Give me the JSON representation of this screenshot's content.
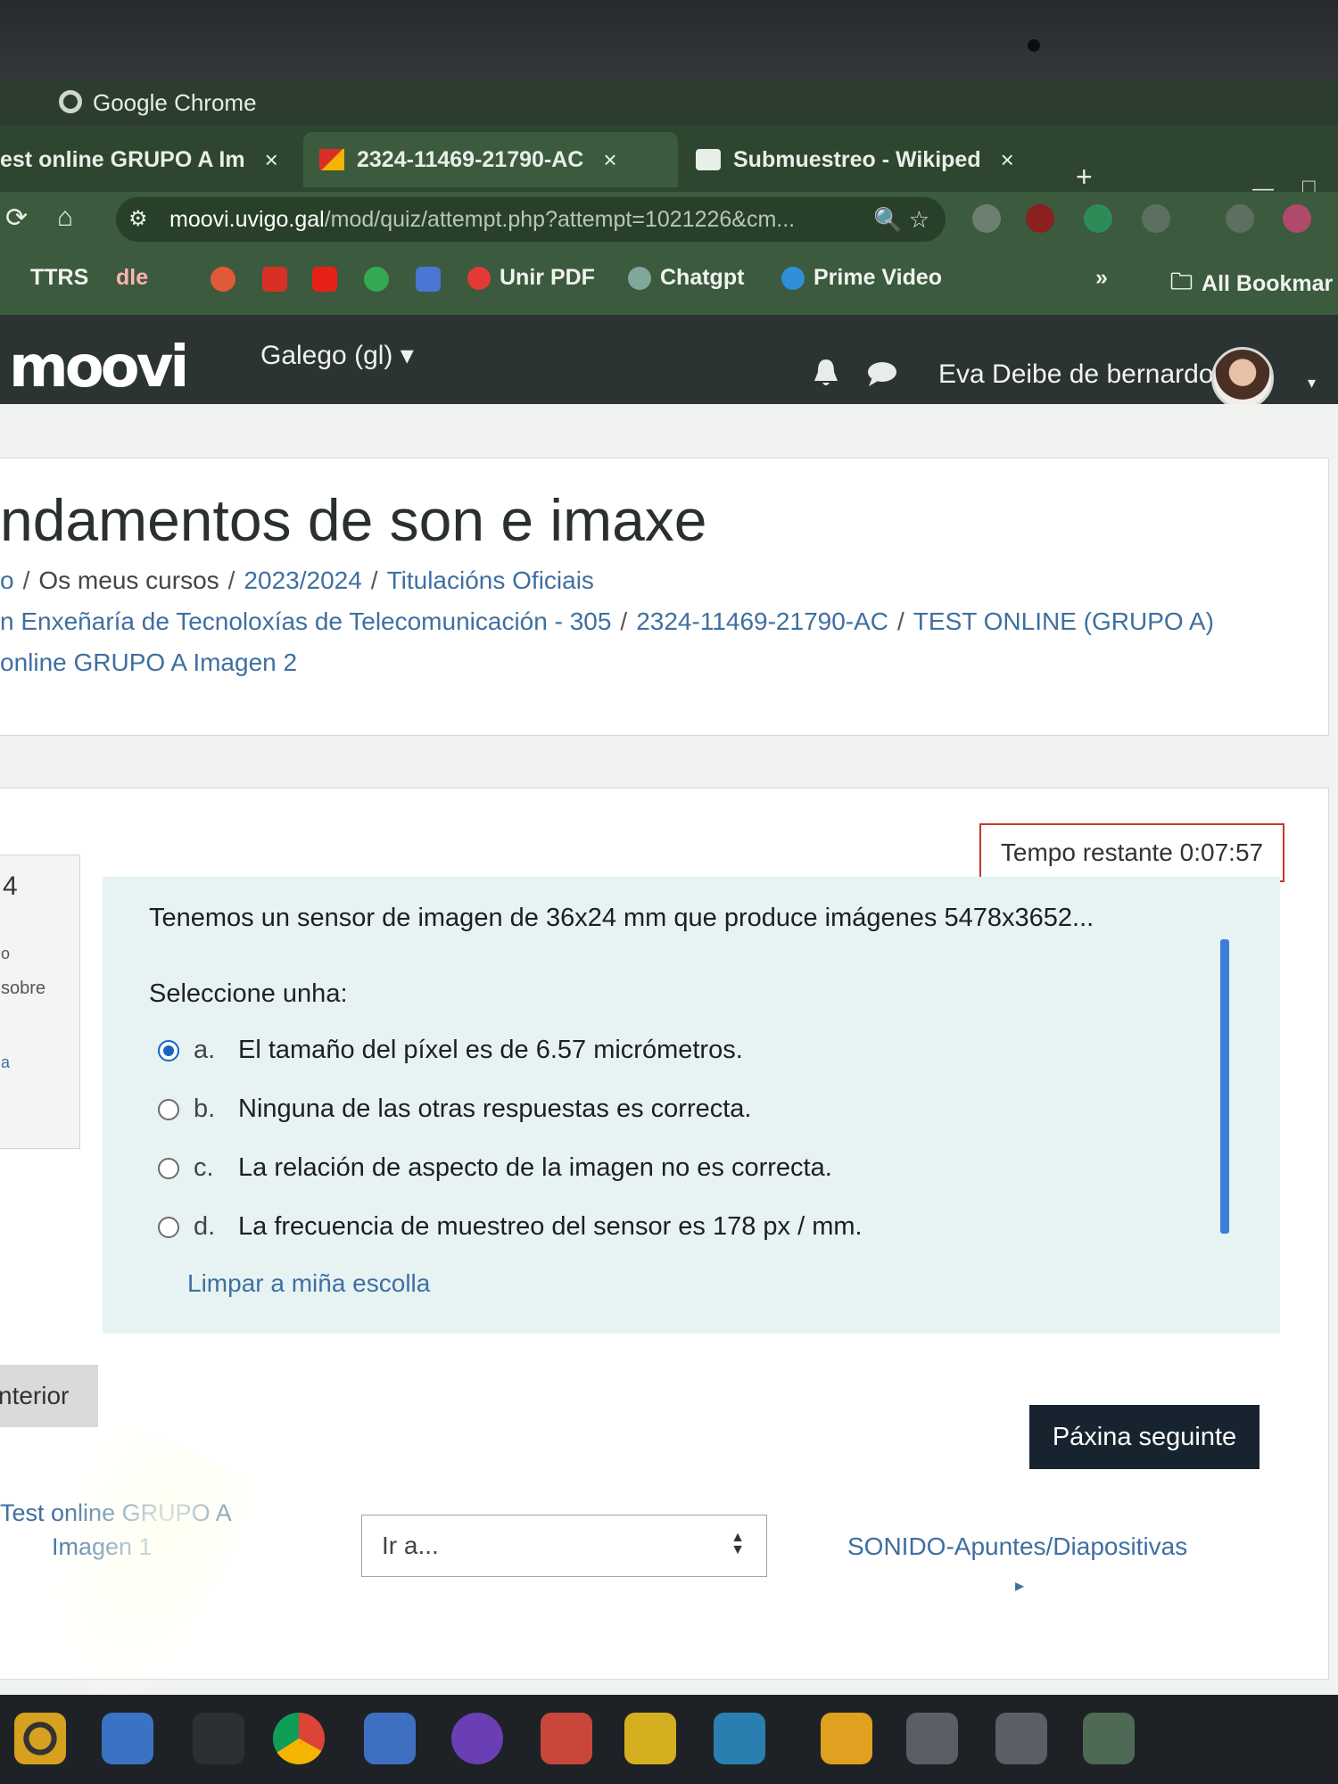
{
  "window": {
    "title": "Google Chrome"
  },
  "tabs": [
    {
      "label": "est online GRUPO A Im",
      "close": "×"
    },
    {
      "label": "2324-11469-21790-AC",
      "close": "×"
    },
    {
      "label": "Submuestreo - Wikiped",
      "close": "×"
    }
  ],
  "new_tab": "+",
  "address": {
    "host": "moovi.uvigo.gal",
    "path": "/mod/quiz/attempt.php?attempt=1021226&cm..."
  },
  "bookmarks": [
    {
      "label": "TTRS"
    },
    {
      "label": "dle"
    },
    {
      "label": "Unir PDF"
    },
    {
      "label": "Chatgpt"
    },
    {
      "label": "Prime Video"
    },
    {
      "label": "»"
    },
    {
      "label": "All Bookmar"
    }
  ],
  "navbar": {
    "logo": "moovi",
    "language": "Galego (gl) ▾",
    "user_name": "Eva Deibe de bernardo",
    "caret": "▾"
  },
  "course": {
    "title": "ndamentos de son e imaxe",
    "breadcrumb_row1": [
      "o",
      "Os meus cursos",
      "2023/2024",
      "Titulacións Oficiais"
    ],
    "breadcrumb_row2": [
      "n Enxeñaría de Tecnoloxías de Telecomunicación - 305",
      "2324-11469-21790-AC",
      "TEST ONLINE (GRUPO A)"
    ],
    "breadcrumb_row3": "online GRUPO A Imagen 2",
    "sep": "/"
  },
  "timer": {
    "label": "Tempo restante 0:07:57"
  },
  "question_info": {
    "number": "4",
    "line1": "o",
    "line2": "sobre",
    "flag": "a"
  },
  "question": {
    "text": "Tenemos un sensor de imagen de 36x24 mm que produce imágenes 5478x3652...",
    "prompt": "Seleccione unha:",
    "answers": [
      {
        "letter": "a.",
        "text": "El tamaño del píxel es de 6.57 micrómetros.",
        "checked": true
      },
      {
        "letter": "b.",
        "text": "Ninguna de las otras respuestas es correcta.",
        "checked": false
      },
      {
        "letter": "c.",
        "text": "La relación de aspecto de la imagen no es correcta.",
        "checked": false
      },
      {
        "letter": "d.",
        "text": "La frecuencia de muestreo del sensor es 178 px / mm.",
        "checked": false
      }
    ],
    "clear_choice": "Limpar a miña escolla"
  },
  "navigation": {
    "previous_page": "nterior",
    "next_page": "Páxina seguinte",
    "prev_activity_line1": "Test online GRUPO A",
    "prev_activity_line2": "Imagen 1",
    "jump_to": "Ir a...",
    "next_activity": "SONIDO-Apuntes/Diapositivas",
    "next_arrow": "▸"
  },
  "colors": {
    "chrome_green": "#3c5a3d",
    "navbar": "#2b3432",
    "link": "#3f6fa0",
    "timer_border": "#c0392b",
    "question_bg": "#e7f3f3",
    "primary_button": "#172430"
  }
}
